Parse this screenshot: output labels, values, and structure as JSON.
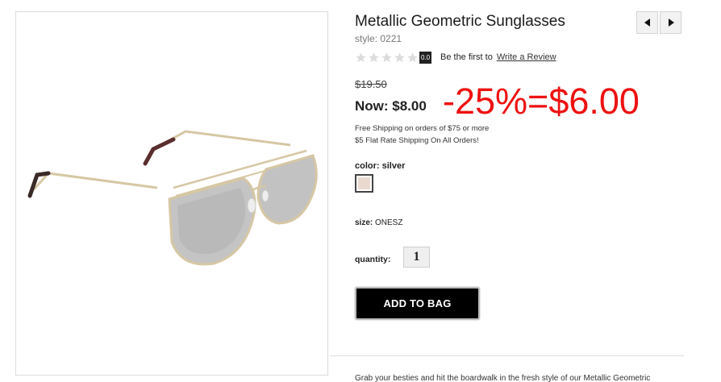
{
  "product": {
    "title": "Metallic Geometric Sunglasses",
    "style": "style: 0221",
    "image_alt": "sunglasses-product-image"
  },
  "navigation": {
    "prev_icon": "caret-left-icon",
    "next_icon": "caret-right-icon"
  },
  "rating": {
    "stars_filled": 0,
    "stars_total": 5,
    "score": "0.0",
    "be_first_text": "Be the first to",
    "review_link": "Write a Review"
  },
  "pricing": {
    "original": "$19.50",
    "now": "Now: $8.00",
    "annotation": "-25%=$6.00"
  },
  "shipping": {
    "line1": "Free Shipping on orders of $75 or more",
    "line2": "$5 Flat Rate Shipping On All Orders!"
  },
  "color": {
    "label": "color:",
    "value": "silver",
    "swatch_hex": "#ead9cf"
  },
  "size": {
    "label": "size:",
    "value": "ONESZ"
  },
  "quantity": {
    "label": "quantity:",
    "value": "1"
  },
  "actions": {
    "add_to_bag": "ADD TO BAG"
  },
  "description": {
    "text": "Grab your besties and hit the boardwalk in the fresh style of our Metallic Geometric"
  },
  "colors": {
    "accent_red": "#ee1111",
    "button_bg": "#000000"
  }
}
